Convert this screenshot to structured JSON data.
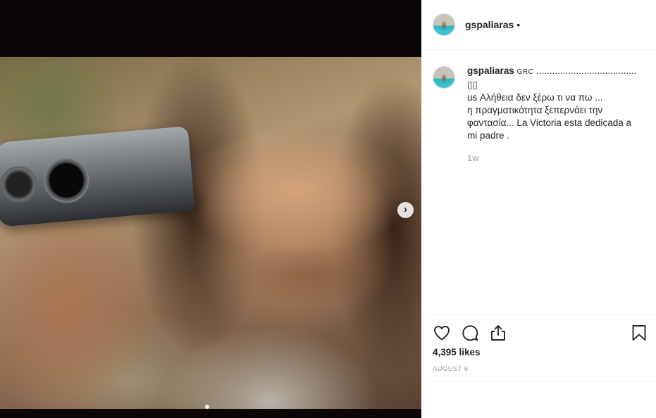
{
  "post": {
    "username": "gspaliaras",
    "header_dot": "•",
    "caption": {
      "flag": "GRC",
      "line1": "......................................",
      "line2": "us Αλήθεια δεν ξέρω τι να πω ...",
      "line3": "η πραγματικότητα ξεπερνάει την",
      "line4": "φαντασία... La Victoria esta dedicada a",
      "line5": "mi padre ."
    },
    "time_ago": "1w",
    "likes": "4,395 likes",
    "date": "AUGUST 6"
  },
  "icons": {
    "like": "heart-icon",
    "comment": "comment-bubble-icon",
    "share": "share-icon",
    "save": "bookmark-icon",
    "next": "chevron-right-icon"
  },
  "colors": {
    "text": "#262626",
    "secondary": "#999999",
    "divider": "#efefef",
    "media_bg": "#0d0606"
  }
}
